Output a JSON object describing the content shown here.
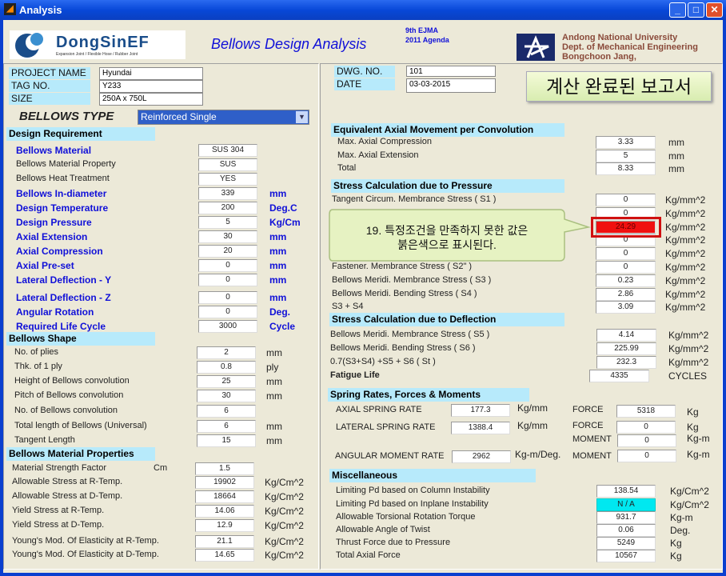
{
  "window": {
    "title": "Analysis"
  },
  "header": {
    "company": "DongSinEF",
    "company_tagline": "Expansion Joint / Flexible Hose / Rubber Joint",
    "app_title": "Bellows Design Analysis",
    "edition_line1": "9th EJMA",
    "edition_line2": "2011 Agenda",
    "university_line1": "Andong National University",
    "university_line2": "Dept. of Mechanical Engineering",
    "university_line3": "Bongchoon Jang,"
  },
  "project": [
    {
      "label": "PROJECT NAME",
      "value": "Hyundai"
    },
    {
      "label": "TAG NO.",
      "value": "Y233"
    },
    {
      "label": "SIZE",
      "value": "250A x 750L"
    }
  ],
  "drawing": [
    {
      "label": "DWG. NO.",
      "value": "101"
    },
    {
      "label": "DATE",
      "value": "03-03-2015"
    }
  ],
  "report_badge": "계산 완료된 보고서",
  "bellows_type": {
    "label": "BELLOWS TYPE",
    "selected": "Reinforced Single"
  },
  "design_requirement": {
    "title": "Design Requirement",
    "rows": [
      {
        "label": "Bellows  Material",
        "value": "SUS 304",
        "unit": "",
        "bold": true
      },
      {
        "label": "Bellows  Material Property",
        "value": "SUS",
        "unit": "",
        "bold": false
      },
      {
        "label": "Bellows  Heat Treatment",
        "value": "YES",
        "unit": "",
        "bold": false
      },
      {
        "label": "Bellows  In-diameter",
        "value": "339",
        "unit": "mm",
        "bold": true
      },
      {
        "label": "Design Temperature",
        "value": "200",
        "unit": "Deg.C",
        "bold": true
      },
      {
        "label": "Design Pressure",
        "value": "5",
        "unit": "Kg/Cm",
        "bold": true
      },
      {
        "label": "Axial Extension",
        "value": "30",
        "unit": "mm",
        "bold": true
      },
      {
        "label": "Axial Compression",
        "value": "20",
        "unit": "mm",
        "bold": true
      },
      {
        "label": "Axial Pre-set",
        "value": "0",
        "unit": "mm",
        "bold": true
      },
      {
        "label": "Lateral Deflection - Y",
        "value": "0",
        "unit": "mm",
        "bold": true
      },
      {
        "label": "Lateral Deflection - Z",
        "value": "0",
        "unit": "mm",
        "bold": true
      },
      {
        "label": "Angular Rotation",
        "value": "0",
        "unit": "Deg.",
        "bold": true
      },
      {
        "label": "Required Life Cycle",
        "value": "3000",
        "unit": "Cycle",
        "bold": true
      }
    ]
  },
  "bellows_shape": {
    "title": "Bellows Shape",
    "rows": [
      {
        "label": "No. of plies",
        "value": "2",
        "unit": "mm"
      },
      {
        "label": "Thk. of 1 ply",
        "value": "0.8",
        "unit": "ply"
      },
      {
        "label": "Height of Bellows convolution",
        "value": "25",
        "unit": "mm"
      },
      {
        "label": "Pitch of Bellows convolution",
        "value": "30",
        "unit": "mm"
      },
      {
        "label": "No. of Bellows convolution",
        "value": "6",
        "unit": ""
      },
      {
        "label": "Total length of Bellows (Universal)",
        "value": "6",
        "unit": "mm"
      },
      {
        "label": "Tangent Length",
        "value": "15",
        "unit": "mm"
      }
    ]
  },
  "material_properties": {
    "title": "Bellows Material Properties",
    "rows": [
      {
        "label": "Material Strength Factor",
        "extra": "Cm",
        "value": "1.5",
        "unit": ""
      },
      {
        "label": "Allowable Stress at R-Temp.",
        "value": "19902",
        "unit": "Kg/Cm^2"
      },
      {
        "label": "Allowable Stress at D-Temp.",
        "value": "18664",
        "unit": "Kg/Cm^2"
      },
      {
        "label": "Yield Stress at R-Temp.",
        "value": "14.06",
        "unit": "Kg/Cm^2"
      },
      {
        "label": "Yield Stress at D-Temp.",
        "value": "12.9",
        "unit": "Kg/Cm^2"
      },
      {
        "label": "Young's Mod. Of Elasticity at R-Temp.",
        "value": "21.1",
        "unit": "Kg/Cm^2"
      },
      {
        "label": "Young's Mod. Of Elasticity at D-Temp.",
        "value": "14.65",
        "unit": "Kg/Cm^2"
      }
    ]
  },
  "axial_movement": {
    "title": "Equivalent Axial Movement per Convolution",
    "rows": [
      {
        "label": "Max. Axial Compression",
        "value": "3.33",
        "unit": "mm"
      },
      {
        "label": "Max. Axial Extension",
        "value": "5",
        "unit": "mm"
      },
      {
        "label": "Total",
        "value": "8.33",
        "unit": "mm"
      }
    ]
  },
  "pressure_stress": {
    "title": "Stress Calculation due to Pressure",
    "rows": [
      {
        "label": "Tangent Circum. Membrance Stress ( S1 )",
        "value": "0",
        "unit": "Kg/mm^2"
      },
      {
        "label": "",
        "value": "0",
        "unit": "Kg/mm^2"
      },
      {
        "label": "",
        "value": "24.29",
        "unit": "Kg/mm^2",
        "alert": true
      },
      {
        "label": "",
        "value": "0",
        "unit": "Kg/mm^2"
      },
      {
        "label": "",
        "value": "0",
        "unit": "Kg/mm^2"
      },
      {
        "label": "Fastener. Membrance Stress ( S2\" )",
        "value": "0",
        "unit": "Kg/mm^2"
      },
      {
        "label": "Bellows Meridi.  Membrance Stress ( S3 )",
        "value": "0.23",
        "unit": "Kg/mm^2"
      },
      {
        "label": "Bellows Meridi.  Bending Stress ( S4 )",
        "value": "2.86",
        "unit": "Kg/mm^2"
      },
      {
        "label": "S3 + S4",
        "value": "3.09",
        "unit": "Kg/mm^2"
      }
    ]
  },
  "callout": {
    "line1": "19. 특정조건을 만족하지 못한 값은",
    "line2": "붉은색으로 표시된다."
  },
  "deflection_stress": {
    "title": "Stress Calculation due to Deflection",
    "rows": [
      {
        "label": "Bellows Meridi.  Membrance Stress ( S5 )",
        "value": "4.14",
        "unit": "Kg/mm^2"
      },
      {
        "label": "Bellows Meridi.  Bending Stress ( S6 )",
        "value": "225.99",
        "unit": "Kg/mm^2"
      },
      {
        "label": "0.7(S3+S4) +S5 + S6 ( St )",
        "value": "232.3",
        "unit": "Kg/mm^2"
      },
      {
        "label": "Fatigue Life",
        "value": "4335",
        "unit": "CYCLES",
        "bold": true
      }
    ]
  },
  "spring": {
    "title": "Spring Rates, Forces & Moments",
    "axial": {
      "label": "AXIAL SPRING RATE",
      "value": "177.3",
      "unit": "Kg/mm",
      "force_label": "FORCE",
      "force": "5318",
      "force_unit": "Kg"
    },
    "lateral": {
      "label": "LATERAL SPRING RATE",
      "value": "1388.4",
      "unit": "Kg/mm",
      "force_label": "FORCE",
      "force": "0",
      "force_unit": "Kg",
      "moment_label": "MOMENT",
      "moment": "0",
      "moment_unit": "Kg-m"
    },
    "angular": {
      "label": "ANGULAR MOMENT RATE",
      "value": "2962",
      "unit": "Kg-m/Deg.",
      "moment_label": "MOMENT",
      "moment": "0",
      "moment_unit": "Kg-m"
    }
  },
  "misc": {
    "title": "Miscellaneous",
    "rows": [
      {
        "label": "Limiting Pd based on Column Instability",
        "value": "138.54",
        "unit": "Kg/Cm^2"
      },
      {
        "label": "Limiting Pd based on Inplane Instability",
        "value": "N / A",
        "unit": "Kg/Cm^2",
        "cyan": true
      },
      {
        "label": "Allowable Torsional Rotation Torque",
        "value": "931.7",
        "unit": "Kg-m"
      },
      {
        "label": "Allowable Angle of Twist",
        "value": "0.06",
        "unit": "Deg."
      },
      {
        "label": "Thrust Force due to Pressure",
        "value": "5249",
        "unit": "Kg"
      },
      {
        "label": "Total Axial Force",
        "value": "10567",
        "unit": "Kg"
      }
    ]
  },
  "colors": {
    "alert": "#f01010",
    "na": "#00e8f0",
    "header_band": "#b7eafb",
    "accent_blue": "#1010d8"
  }
}
